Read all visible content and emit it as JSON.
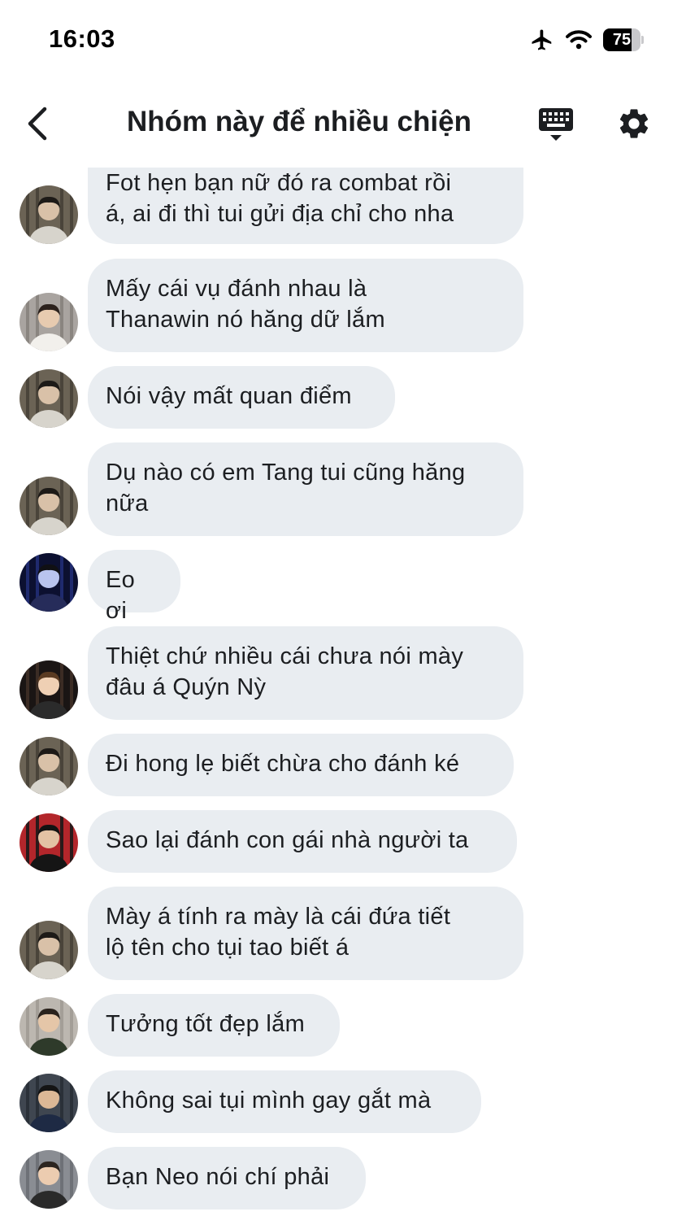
{
  "status_bar": {
    "time": "16:03",
    "battery_level": "75",
    "icons": [
      "airplane-icon",
      "wifi-icon",
      "battery-icon"
    ]
  },
  "header": {
    "title": "Nhóm này để nhiều chiện",
    "back_icon": "chevron-left-icon",
    "keyboard_icon": "keyboard-icon",
    "settings_icon": "gear-icon"
  },
  "colors": {
    "bubble_bg": "#e9edf1",
    "text": "#1c1e21"
  },
  "messages": [
    {
      "text": "Fot hẹn bạn nữ đó ra combat rồi\ná, ai đi thì tui gửi địa chỉ cho nha",
      "avatar": "avatar-a"
    },
    {
      "text": "Mấy cái vụ đánh nhau là\nThanawin nó hăng dữ lắm",
      "avatar": "avatar-b"
    },
    {
      "text": "Nói vậy mất quan điểm",
      "avatar": "avatar-a"
    },
    {
      "text": "Dụ nào có em Tang tui cũng hăng\nnữa",
      "avatar": "avatar-a"
    },
    {
      "text": "Eo ơi",
      "avatar": "avatar-c"
    },
    {
      "text": "Thiệt chứ nhiều cái chưa nói mày\nđâu á Quýn Nỳ",
      "avatar": "avatar-d"
    },
    {
      "text": "Đi hong lẹ biết chừa cho đánh ké",
      "avatar": "avatar-a"
    },
    {
      "text": "Sao lại đánh con gái nhà người ta",
      "avatar": "avatar-e"
    },
    {
      "text": "Mày á tính ra mày là cái đứa tiết\nlộ tên cho tụi tao biết á",
      "avatar": "avatar-a"
    },
    {
      "text": "Tưởng tốt đẹp lắm",
      "avatar": "avatar-f"
    },
    {
      "text": "Không sai tụi mình gay gắt mà",
      "avatar": "avatar-g"
    },
    {
      "text": "Bạn Neo nói chí phải",
      "avatar": "avatar-h"
    }
  ]
}
